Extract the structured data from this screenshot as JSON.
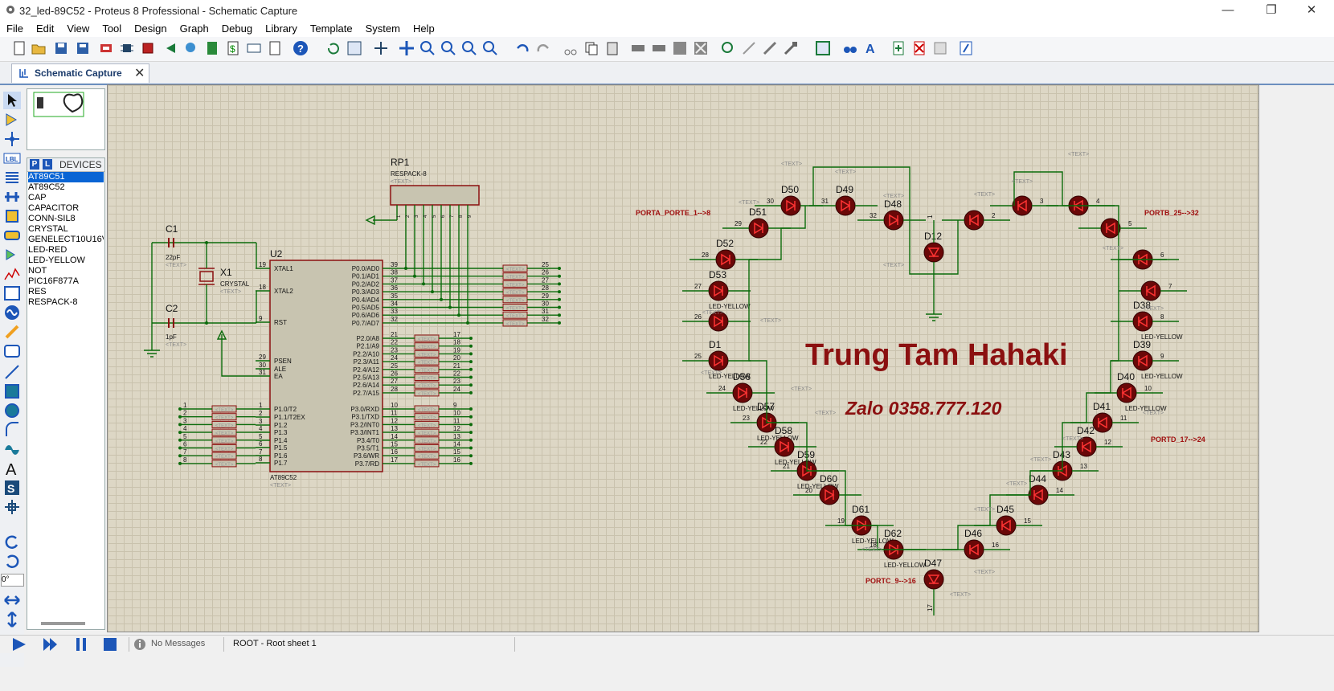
{
  "window": {
    "title": "32_led-89C52 - Proteus 8 Professional - Schematic Capture"
  },
  "menu": [
    "File",
    "Edit",
    "View",
    "Tool",
    "Design",
    "Graph",
    "Debug",
    "Library",
    "Template",
    "System",
    "Help"
  ],
  "tab": {
    "label": "Schematic Capture"
  },
  "devices": {
    "header": "DEVICES",
    "p_button": "P",
    "l_button": "L",
    "items": [
      "AT89C51",
      "AT89C52",
      "CAP",
      "CAPACITOR",
      "CONN-SIL8",
      "CRYSTAL",
      "GENELECT10U16V",
      "LED-RED",
      "LED-YELLOW",
      "NOT",
      "PIC16F877A",
      "RES",
      "RESPACK-8"
    ],
    "selected": "AT89C51"
  },
  "left_tools": {
    "rotation": "0°"
  },
  "status": {
    "messages": "No Messages",
    "sheet": "ROOT - Root sheet 1"
  },
  "schematic": {
    "watermark": "Trung Tam Hahaki",
    "contact": "Zalo 0358.777.120",
    "mcu": {
      "ref": "U2",
      "part": "AT89C52",
      "text": "<TEXT>",
      "left_pins": [
        {
          "num": "19",
          "name": "XTAL1"
        },
        {
          "num": "18",
          "name": "XTAL2"
        },
        {
          "num": "9",
          "name": "RST"
        },
        {
          "num": "29",
          "name": "PSEN"
        },
        {
          "num": "30",
          "name": "ALE"
        },
        {
          "num": "31",
          "name": "EA"
        },
        {
          "num": "1",
          "name": "P1.0/T2"
        },
        {
          "num": "2",
          "name": "P1.1/T2EX"
        },
        {
          "num": "3",
          "name": "P1.2"
        },
        {
          "num": "4",
          "name": "P1.3"
        },
        {
          "num": "5",
          "name": "P1.4"
        },
        {
          "num": "6",
          "name": "P1.5"
        },
        {
          "num": "7",
          "name": "P1.6"
        },
        {
          "num": "8",
          "name": "P1.7"
        }
      ],
      "right_pins_p0": [
        {
          "num": "39",
          "name": "P0.0/AD0"
        },
        {
          "num": "38",
          "name": "P0.1/AD1"
        },
        {
          "num": "37",
          "name": "P0.2/AD2"
        },
        {
          "num": "36",
          "name": "P0.3/AD3"
        },
        {
          "num": "35",
          "name": "P0.4/AD4"
        },
        {
          "num": "34",
          "name": "P0.5/AD5"
        },
        {
          "num": "33",
          "name": "P0.6/AD6"
        },
        {
          "num": "32",
          "name": "P0.7/AD7"
        }
      ],
      "right_pins_p2": [
        {
          "num": "21",
          "name": "P2.0/A8"
        },
        {
          "num": "22",
          "name": "P2.1/A9"
        },
        {
          "num": "23",
          "name": "P2.2/A10"
        },
        {
          "num": "24",
          "name": "P2.3/A11"
        },
        {
          "num": "25",
          "name": "P2.4/A12"
        },
        {
          "num": "26",
          "name": "P2.5/A13"
        },
        {
          "num": "27",
          "name": "P2.6/A14"
        },
        {
          "num": "28",
          "name": "P2.7/A15"
        }
      ],
      "right_pins_p3": [
        {
          "num": "10",
          "name": "P3.0/RXD"
        },
        {
          "num": "11",
          "name": "P3.1/TXD"
        },
        {
          "num": "12",
          "name": "P3.2/INT0"
        },
        {
          "num": "13",
          "name": "P3.3/INT1"
        },
        {
          "num": "14",
          "name": "P3.4/T0"
        },
        {
          "num": "15",
          "name": "P3.5/T1"
        },
        {
          "num": "16",
          "name": "P3.6/WR"
        },
        {
          "num": "17",
          "name": "P3.7/RD"
        }
      ]
    },
    "p0_labels": [
      "25",
      "26",
      "27",
      "28",
      "29",
      "30",
      "31",
      "32"
    ],
    "p2_labels": [
      "17",
      "18",
      "19",
      "20",
      "21",
      "22",
      "23",
      "24"
    ],
    "p3_labels": [
      "9",
      "10",
      "11",
      "12",
      "13",
      "14",
      "15",
      "16"
    ],
    "p1_labels": [
      "1",
      "2",
      "3",
      "4",
      "5",
      "6",
      "7",
      "8"
    ],
    "rp1": {
      "ref": "RP1",
      "part": "RESPACK-8",
      "text": "<TEXT>",
      "pins": [
        "1",
        "2",
        "3",
        "4",
        "5",
        "6",
        "7",
        "8",
        "9"
      ]
    },
    "c1": {
      "ref": "C1",
      "value": "22pF",
      "text": "<TEXT>"
    },
    "c2": {
      "ref": "C2",
      "value": "1pF",
      "text": "<TEXT>"
    },
    "x1": {
      "ref": "X1",
      "part": "CRYSTAL",
      "text": "<TEXT>"
    },
    "port_labels": [
      {
        "text": "PORTA_PORTE_1-->8"
      },
      {
        "text": "PORTB_25-->32"
      },
      {
        "text": "PORTD_17-->24"
      },
      {
        "text": "PORTC_9-->16"
      }
    ],
    "leds": [
      {
        "ref": "D50",
        "pin": "30"
      },
      {
        "ref": "D49",
        "pin": "31"
      },
      {
        "ref": "D48",
        "pin": "32"
      },
      {
        "ref": "D51",
        "pin": "29"
      },
      {
        "ref": "D52",
        "pin": "28"
      },
      {
        "ref": "D53",
        "pin": "27"
      },
      {
        "ref": "",
        "pin": "26"
      },
      {
        "ref": "D1",
        "pin": "25"
      },
      {
        "ref": "D56",
        "pin": "24"
      },
      {
        "ref": "D57",
        "pin": "23"
      },
      {
        "ref": "D58",
        "pin": "22"
      },
      {
        "ref": "D59",
        "pin": "21"
      },
      {
        "ref": "D60",
        "pin": "20"
      },
      {
        "ref": "D61",
        "pin": "19"
      },
      {
        "ref": "D62",
        "pin": "18"
      },
      {
        "ref": "D47",
        "pin": "17"
      },
      {
        "ref": "D12",
        "pin": "1"
      },
      {
        "ref": "",
        "pin": "2"
      },
      {
        "ref": "",
        "pin": "3"
      },
      {
        "ref": "",
        "pin": "4"
      },
      {
        "ref": "",
        "pin": "5"
      },
      {
        "ref": "",
        "pin": "6"
      },
      {
        "ref": "",
        "pin": "7"
      },
      {
        "ref": "D38",
        "pin": "8"
      },
      {
        "ref": "D39",
        "pin": "9"
      },
      {
        "ref": "D40",
        "pin": "10"
      },
      {
        "ref": "D41",
        "pin": "11"
      },
      {
        "ref": "D42",
        "pin": "12"
      },
      {
        "ref": "D43",
        "pin": "13"
      },
      {
        "ref": "D44",
        "pin": "14"
      },
      {
        "ref": "D45",
        "pin": "15"
      },
      {
        "ref": "D46",
        "pin": "16"
      }
    ],
    "led_value": "LED-YELLOW",
    "text_placeholder": "<TEXT>"
  },
  "colors": {
    "canvas": "#ddd7c5",
    "grid": "#c9c2ad",
    "wire": "#0b6b0b",
    "component": "#8b1010",
    "chip_fill": "#c8c4b0",
    "watermark": "#8b1010",
    "port_label": "#a01010"
  }
}
